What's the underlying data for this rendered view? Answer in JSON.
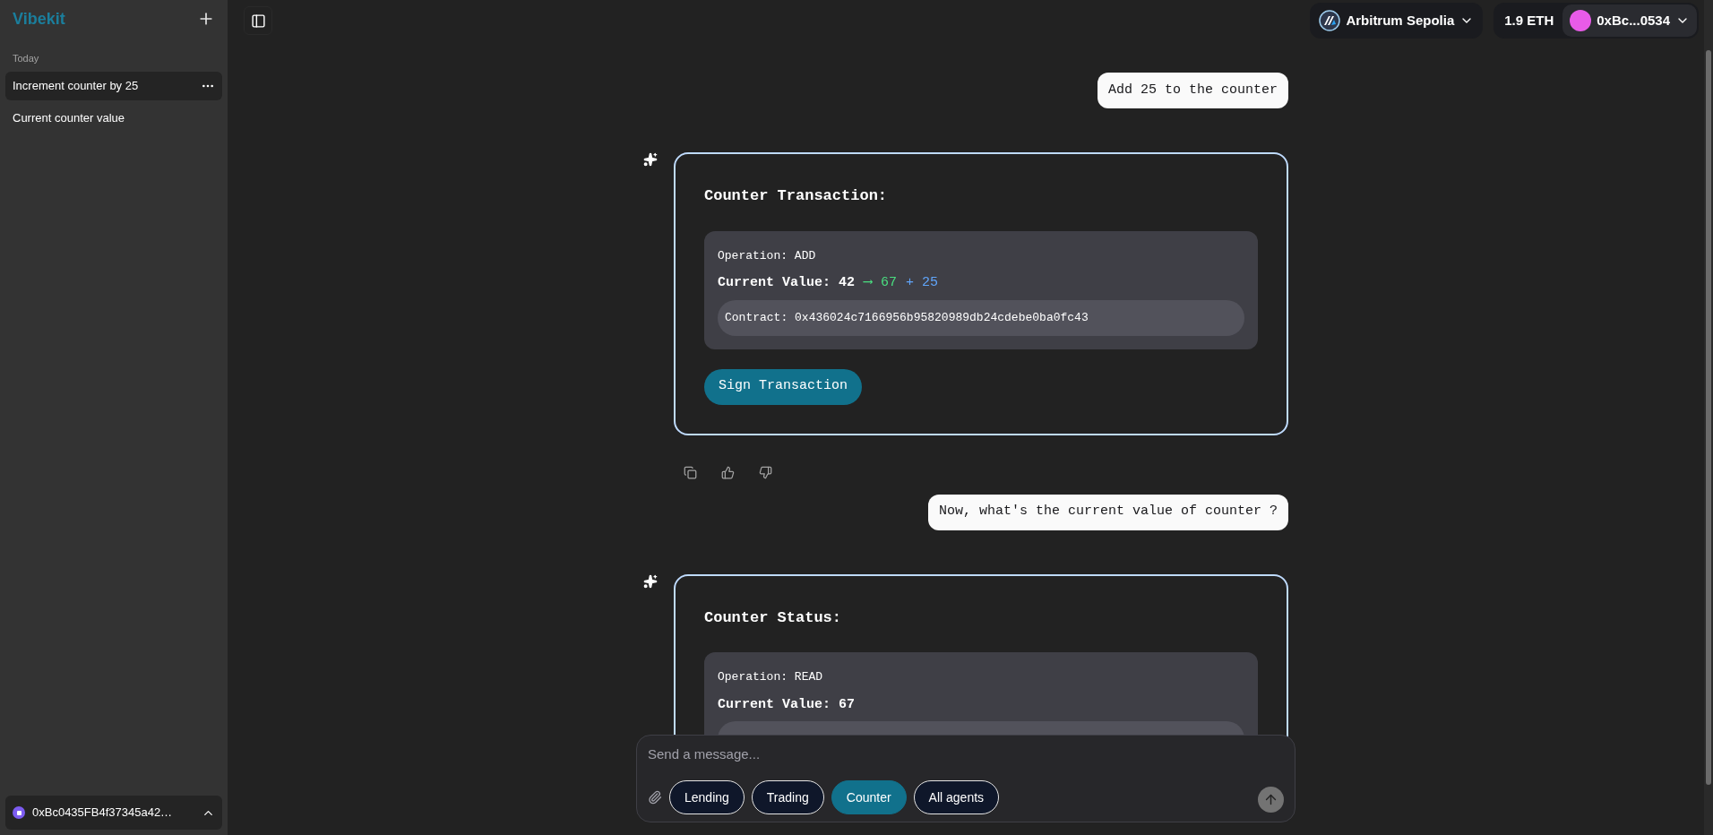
{
  "sidebar": {
    "brand": "Vibekit",
    "section": "Today",
    "chats": [
      {
        "title": "Increment counter by 25",
        "selected": true
      },
      {
        "title": "Current counter value",
        "selected": false
      }
    ],
    "user": "0xBc0435FB4f37345a42…"
  },
  "header": {
    "network": "Arbitrum Sepolia",
    "balance": "1.9 ETH",
    "account": "0xBc...0534"
  },
  "messages": [
    {
      "kind": "user",
      "text": "Add 25 to the counter"
    },
    {
      "kind": "assistant",
      "actions": true,
      "card": {
        "title": "Counter Transaction:",
        "operation_label": "Operation:",
        "operation": "ADD",
        "value_label": "Current Value:",
        "value": "42",
        "arrow": "⟶",
        "new_value": "67",
        "delta": "+ 25",
        "contract_label": "Contract:",
        "contract": "0x436024c7166956b95820989db24cdebe0ba0fc43",
        "button": "Sign Transaction"
      }
    },
    {
      "kind": "user",
      "text": "Now, what's the current value of counter ?"
    },
    {
      "kind": "assistant",
      "actions": false,
      "card": {
        "title": "Counter Status:",
        "operation_label": "Operation:",
        "operation": "READ",
        "value_label": "Current Value:",
        "value": "67"
      }
    }
  ],
  "composer": {
    "placeholder": "Send a message...",
    "agents": [
      {
        "label": "Lending",
        "selected": false
      },
      {
        "label": "Trading",
        "selected": false
      },
      {
        "label": "Counter",
        "selected": true
      },
      {
        "label": "All agents",
        "selected": false
      }
    ]
  }
}
